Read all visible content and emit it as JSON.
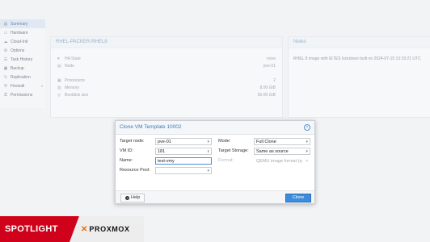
{
  "sidebar": {
    "items": [
      {
        "label": "Summary",
        "icon": "book-icon",
        "glyph": "▤",
        "active": true
      },
      {
        "label": "Hardware",
        "icon": "desktop-icon",
        "glyph": "▭"
      },
      {
        "label": "Cloud-Init",
        "icon": "cloud-icon",
        "glyph": "☁"
      },
      {
        "label": "Options",
        "icon": "gear-icon",
        "glyph": "⚙"
      },
      {
        "label": "Task History",
        "icon": "list-icon",
        "glyph": "☰"
      },
      {
        "label": "Backup",
        "icon": "floppy-icon",
        "glyph": "▣"
      },
      {
        "label": "Replication",
        "icon": "retweet-icon",
        "glyph": "↻"
      },
      {
        "label": "Firewall",
        "icon": "shield-icon",
        "glyph": "⛨"
      },
      {
        "label": "Permissions",
        "icon": "unlock-icon",
        "glyph": "⚿"
      }
    ]
  },
  "summary": {
    "title": "RHEL-PACKER-RHEL8",
    "rows": [
      {
        "label": "HA State",
        "value": "none"
      },
      {
        "label": "Node",
        "value": "pve-01"
      },
      {
        "label": "Processors",
        "value": "2"
      },
      {
        "label": "Memory",
        "value": "8.00 GiB"
      },
      {
        "label": "Bootdisk size",
        "value": "50.00 GiB"
      }
    ]
  },
  "notes": {
    "title": "Notes",
    "text": "RHEL 8 image with IETES lockdown built on 2024-07-15 13:19:21 UTC"
  },
  "dialog": {
    "title": "Clone VM Template 10002",
    "target_node_label": "Target node:",
    "target_node_value": "pve-01",
    "vm_id_label": "VM ID:",
    "vm_id_value": "181",
    "name_label": "Name:",
    "name_value": "test-vmy",
    "resource_pool_label": "Resource Pool:",
    "resource_pool_value": "",
    "mode_label": "Mode:",
    "mode_value": "Full Clone",
    "target_storage_label": "Target Storage:",
    "target_storage_value": "Same as source",
    "format_label": "Format:",
    "format_value": "QEMU image format (q",
    "help_label": "Help",
    "clone_label": "Clone"
  },
  "banner": {
    "spotlight": "SPOTLIGHT",
    "brand": "PROXMOX"
  }
}
